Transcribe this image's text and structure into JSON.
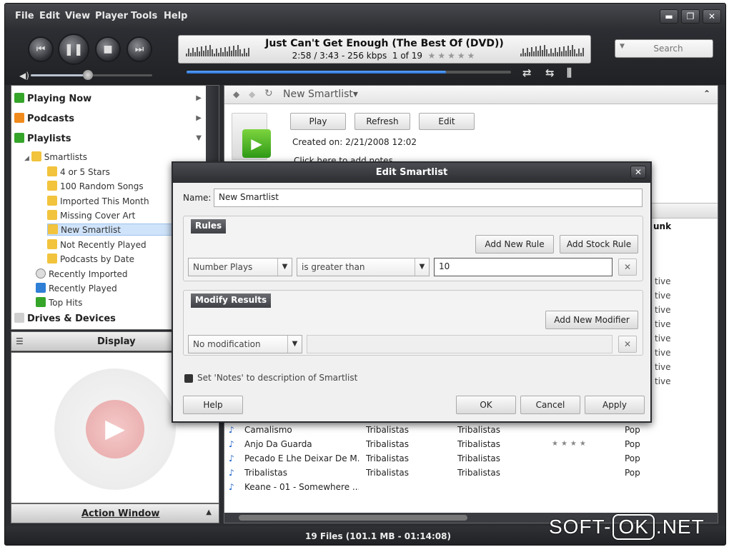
{
  "menu": [
    "File",
    "Edit",
    "View",
    "Player",
    "Tools",
    "Help"
  ],
  "window_buttons": {
    "minimize": "▬",
    "maximize": "❐",
    "close": "✕"
  },
  "now_playing": {
    "title": "Just Can't Get Enough (The Best Of (DVD))",
    "time_info": "2:58 / 3:43 - 256 kbps",
    "track_info": "1 of 19",
    "rating_stars": "★★★★★",
    "progress_percent": 80,
    "volume_percent": 47
  },
  "search": {
    "placeholder": "Search"
  },
  "sidebar": {
    "playing_now": "Playing Now",
    "podcasts": "Podcasts",
    "playlists": "Playlists",
    "smartlists": "Smartlists",
    "smartlist_items": [
      "4 or 5 Stars",
      "100 Random Songs",
      "Imported This Month",
      "Missing Cover Art",
      "New Smartlist",
      "Not Recently Played",
      "Podcasts by Date"
    ],
    "playlist_items": [
      "Recently Imported",
      "Recently Played",
      "Top Hits"
    ],
    "drives": "Drives & Devices",
    "display_label": "Display",
    "action_window_label": "Action Window"
  },
  "main": {
    "breadcrumb": "New Smartlist",
    "play_button": "Play",
    "refresh_button": "Refresh",
    "edit_button": "Edit",
    "created": "Created on: 2/21/2008 12:02",
    "notes_link": "Click here to add notes",
    "genre_header_partial": "unk",
    "genre_partial_rows": [
      "tive",
      "tive",
      "tive",
      "tive",
      "tive",
      "tive",
      "tive",
      "tive"
    ],
    "rows": [
      {
        "title": "Camalismo",
        "artist": "Tribalistas",
        "album": "Tribalistas",
        "rating": "",
        "genre": "Pop"
      },
      {
        "title": "Anjo Da Guarda",
        "artist": "Tribalistas",
        "album": "Tribalistas",
        "rating": "★★★★",
        "genre": "Pop"
      },
      {
        "title": "Pecado E Lhe Deixar De M...",
        "artist": "Tribalistas",
        "album": "Tribalistas",
        "rating": "",
        "genre": "Pop"
      },
      {
        "title": "Tribalistas",
        "artist": "Tribalistas",
        "album": "Tribalistas",
        "rating": "",
        "genre": "Pop"
      },
      {
        "title": "Keane - 01 - Somewhere ...",
        "artist": "",
        "album": "",
        "rating": "",
        "genre": ""
      }
    ]
  },
  "status": "19 Files (101.1 MB - 01:14:08)",
  "dialog": {
    "title": "Edit Smartlist",
    "name_label": "Name:",
    "name_value": "New Smartlist",
    "rules_title": "Rules",
    "add_new_rule": "Add New Rule",
    "add_stock_rule": "Add Stock Rule",
    "rule_field": "Number Plays",
    "rule_operator": "is greater than",
    "rule_value": "10",
    "modify_title": "Modify Results",
    "add_new_modifier": "Add New Modifier",
    "modifier": "No modification",
    "notes_checkbox": "Set 'Notes' to description of Smartlist",
    "help": "Help",
    "ok": "OK",
    "cancel": "Cancel",
    "apply": "Apply"
  },
  "watermark": {
    "left": "SOFT-",
    "box": "OK",
    "right": ".NET"
  }
}
